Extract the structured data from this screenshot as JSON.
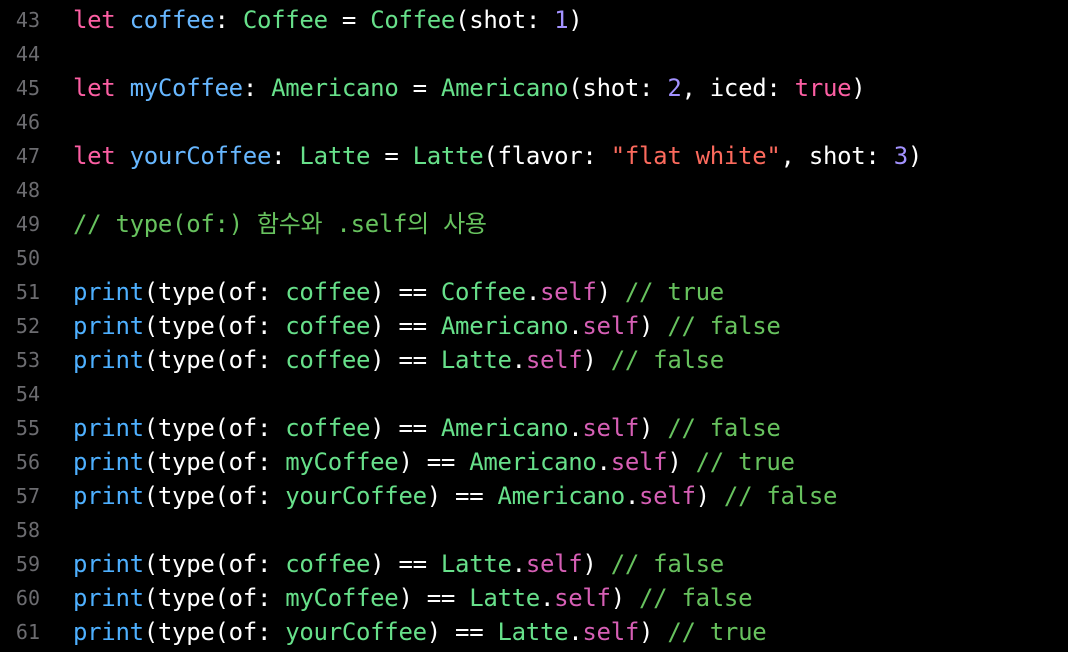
{
  "editor": {
    "lines": [
      {
        "num": "43",
        "tokens": [
          {
            "t": "let",
            "c": "kw"
          },
          {
            "t": " ",
            "c": "plain"
          },
          {
            "t": "coffee",
            "c": "var"
          },
          {
            "t": ": ",
            "c": "plain"
          },
          {
            "t": "Coffee",
            "c": "type"
          },
          {
            "t": " = ",
            "c": "plain"
          },
          {
            "t": "Coffee",
            "c": "type"
          },
          {
            "t": "(shot: ",
            "c": "plain"
          },
          {
            "t": "1",
            "c": "num"
          },
          {
            "t": ")",
            "c": "plain"
          }
        ]
      },
      {
        "num": "44",
        "tokens": []
      },
      {
        "num": "45",
        "tokens": [
          {
            "t": "let",
            "c": "kw"
          },
          {
            "t": " ",
            "c": "plain"
          },
          {
            "t": "myCoffee",
            "c": "var"
          },
          {
            "t": ": ",
            "c": "plain"
          },
          {
            "t": "Americano",
            "c": "type"
          },
          {
            "t": " = ",
            "c": "plain"
          },
          {
            "t": "Americano",
            "c": "type"
          },
          {
            "t": "(shot: ",
            "c": "plain"
          },
          {
            "t": "2",
            "c": "num"
          },
          {
            "t": ", iced: ",
            "c": "plain"
          },
          {
            "t": "true",
            "c": "kw"
          },
          {
            "t": ")",
            "c": "plain"
          }
        ]
      },
      {
        "num": "46",
        "tokens": []
      },
      {
        "num": "47",
        "tokens": [
          {
            "t": "let",
            "c": "kw"
          },
          {
            "t": " ",
            "c": "plain"
          },
          {
            "t": "yourCoffee",
            "c": "var"
          },
          {
            "t": ": ",
            "c": "plain"
          },
          {
            "t": "Latte",
            "c": "type"
          },
          {
            "t": " = ",
            "c": "plain"
          },
          {
            "t": "Latte",
            "c": "type"
          },
          {
            "t": "(flavor: ",
            "c": "plain"
          },
          {
            "t": "\"flat white\"",
            "c": "str"
          },
          {
            "t": ", shot: ",
            "c": "plain"
          },
          {
            "t": "3",
            "c": "num"
          },
          {
            "t": ")",
            "c": "plain"
          }
        ]
      },
      {
        "num": "48",
        "tokens": []
      },
      {
        "num": "49",
        "tokens": [
          {
            "t": "// type(of:) 함수와 .self의 사용",
            "c": "comment"
          }
        ]
      },
      {
        "num": "50",
        "tokens": []
      },
      {
        "num": "51",
        "tokens": [
          {
            "t": "print",
            "c": "fn"
          },
          {
            "t": "(type(of: ",
            "c": "plain"
          },
          {
            "t": "coffee",
            "c": "type"
          },
          {
            "t": ") == ",
            "c": "plain"
          },
          {
            "t": "Coffee",
            "c": "type"
          },
          {
            "t": ".",
            "c": "plain"
          },
          {
            "t": "self",
            "c": "selfkw"
          },
          {
            "t": ") ",
            "c": "plain"
          },
          {
            "t": "// true",
            "c": "comment"
          }
        ]
      },
      {
        "num": "52",
        "tokens": [
          {
            "t": "print",
            "c": "fn"
          },
          {
            "t": "(type(of: ",
            "c": "plain"
          },
          {
            "t": "coffee",
            "c": "type"
          },
          {
            "t": ") == ",
            "c": "plain"
          },
          {
            "t": "Americano",
            "c": "type"
          },
          {
            "t": ".",
            "c": "plain"
          },
          {
            "t": "self",
            "c": "selfkw"
          },
          {
            "t": ") ",
            "c": "plain"
          },
          {
            "t": "// false",
            "c": "comment"
          }
        ]
      },
      {
        "num": "53",
        "tokens": [
          {
            "t": "print",
            "c": "fn"
          },
          {
            "t": "(type(of: ",
            "c": "plain"
          },
          {
            "t": "coffee",
            "c": "type"
          },
          {
            "t": ") == ",
            "c": "plain"
          },
          {
            "t": "Latte",
            "c": "type"
          },
          {
            "t": ".",
            "c": "plain"
          },
          {
            "t": "self",
            "c": "selfkw"
          },
          {
            "t": ") ",
            "c": "plain"
          },
          {
            "t": "// false",
            "c": "comment"
          }
        ]
      },
      {
        "num": "54",
        "tokens": []
      },
      {
        "num": "55",
        "tokens": [
          {
            "t": "print",
            "c": "fn"
          },
          {
            "t": "(type(of: ",
            "c": "plain"
          },
          {
            "t": "coffee",
            "c": "type"
          },
          {
            "t": ") == ",
            "c": "plain"
          },
          {
            "t": "Americano",
            "c": "type"
          },
          {
            "t": ".",
            "c": "plain"
          },
          {
            "t": "self",
            "c": "selfkw"
          },
          {
            "t": ") ",
            "c": "plain"
          },
          {
            "t": "// false",
            "c": "comment"
          }
        ]
      },
      {
        "num": "56",
        "tokens": [
          {
            "t": "print",
            "c": "fn"
          },
          {
            "t": "(type(of: ",
            "c": "plain"
          },
          {
            "t": "myCoffee",
            "c": "type"
          },
          {
            "t": ") == ",
            "c": "plain"
          },
          {
            "t": "Americano",
            "c": "type"
          },
          {
            "t": ".",
            "c": "plain"
          },
          {
            "t": "self",
            "c": "selfkw"
          },
          {
            "t": ") ",
            "c": "plain"
          },
          {
            "t": "// true",
            "c": "comment"
          }
        ]
      },
      {
        "num": "57",
        "tokens": [
          {
            "t": "print",
            "c": "fn"
          },
          {
            "t": "(type(of: ",
            "c": "plain"
          },
          {
            "t": "yourCoffee",
            "c": "type"
          },
          {
            "t": ") == ",
            "c": "plain"
          },
          {
            "t": "Americano",
            "c": "type"
          },
          {
            "t": ".",
            "c": "plain"
          },
          {
            "t": "self",
            "c": "selfkw"
          },
          {
            "t": ") ",
            "c": "plain"
          },
          {
            "t": "// false",
            "c": "comment"
          }
        ]
      },
      {
        "num": "58",
        "tokens": []
      },
      {
        "num": "59",
        "tokens": [
          {
            "t": "print",
            "c": "fn"
          },
          {
            "t": "(type(of: ",
            "c": "plain"
          },
          {
            "t": "coffee",
            "c": "type"
          },
          {
            "t": ") == ",
            "c": "plain"
          },
          {
            "t": "Latte",
            "c": "type"
          },
          {
            "t": ".",
            "c": "plain"
          },
          {
            "t": "self",
            "c": "selfkw"
          },
          {
            "t": ") ",
            "c": "plain"
          },
          {
            "t": "// false",
            "c": "comment"
          }
        ]
      },
      {
        "num": "60",
        "tokens": [
          {
            "t": "print",
            "c": "fn"
          },
          {
            "t": "(type(of: ",
            "c": "plain"
          },
          {
            "t": "myCoffee",
            "c": "type"
          },
          {
            "t": ") == ",
            "c": "plain"
          },
          {
            "t": "Latte",
            "c": "type"
          },
          {
            "t": ".",
            "c": "plain"
          },
          {
            "t": "self",
            "c": "selfkw"
          },
          {
            "t": ") ",
            "c": "plain"
          },
          {
            "t": "// false",
            "c": "comment"
          }
        ]
      },
      {
        "num": "61",
        "tokens": [
          {
            "t": "print",
            "c": "fn"
          },
          {
            "t": "(type(of: ",
            "c": "plain"
          },
          {
            "t": "yourCoffee",
            "c": "type"
          },
          {
            "t": ") == ",
            "c": "plain"
          },
          {
            "t": "Latte",
            "c": "type"
          },
          {
            "t": ".",
            "c": "plain"
          },
          {
            "t": "self",
            "c": "selfkw"
          },
          {
            "t": ") ",
            "c": "plain"
          },
          {
            "t": "// true",
            "c": "comment"
          }
        ]
      }
    ]
  }
}
